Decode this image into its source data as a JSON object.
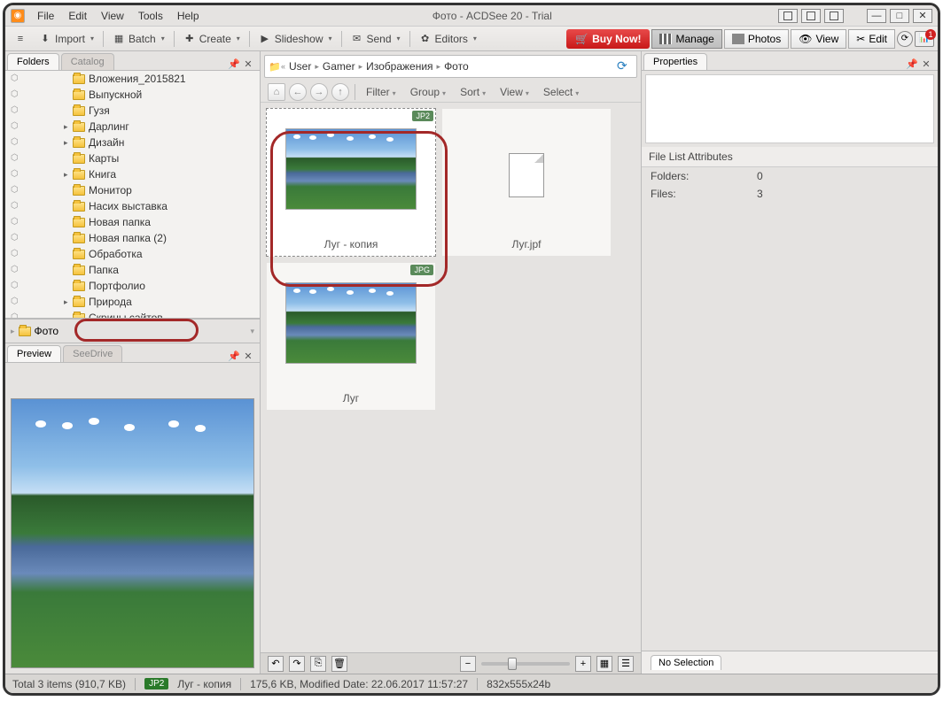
{
  "title": "Фото - ACDSee 20 - Trial",
  "menubar": [
    "File",
    "Edit",
    "View",
    "Tools",
    "Help"
  ],
  "toolbar": {
    "import": "Import",
    "batch": "Batch",
    "create": "Create",
    "slideshow": "Slideshow",
    "send": "Send",
    "editors": "Editors",
    "buy_now": "Buy Now!",
    "manage": "Manage",
    "photos": "Photos",
    "view": "View",
    "edit": "Edit",
    "notification_count": "1"
  },
  "left_panel": {
    "tabs": {
      "folders": "Folders",
      "catalog": "Catalog"
    },
    "tree": [
      "Вложения_2015821",
      "Выпускной",
      "Гузя",
      "Дарлинг",
      "Дизайн",
      "Карты",
      "Книга",
      "Монитор",
      "Насих выставка",
      "Новая папка",
      "Новая папка (2)",
      "Обработка",
      "Папка",
      "Портфолио",
      "Природа",
      "Скрины сайтов"
    ],
    "easy_select": "Фото",
    "preview_tabs": {
      "preview": "Preview",
      "seedrive": "SeeDrive"
    }
  },
  "breadcrumb": [
    "User",
    "Gamer",
    "Изображения",
    "Фото"
  ],
  "view_toolbar": [
    "Filter",
    "Group",
    "Sort",
    "View",
    "Select"
  ],
  "thumbnails": [
    {
      "name": "Луг - копия",
      "badge": "JP2",
      "selected": true,
      "type": "image"
    },
    {
      "name": "Луг.jpf",
      "badge": "",
      "selected": false,
      "type": "generic"
    },
    {
      "name": "Луг",
      "badge": "JPG",
      "selected": false,
      "type": "image"
    }
  ],
  "properties": {
    "title": "Properties",
    "section": "File List Attributes",
    "rows": [
      {
        "label": "Folders:",
        "value": "0"
      },
      {
        "label": "Files:",
        "value": "3"
      }
    ],
    "no_selection": "No Selection"
  },
  "statusbar": {
    "total": "Total 3 items  (910,7 KB)",
    "badge": "JP2",
    "filename": "Луг - копия",
    "details": "175,6 KB, Modified Date: 22.06.2017 11:57:27",
    "dimensions": "832x555x24b"
  }
}
